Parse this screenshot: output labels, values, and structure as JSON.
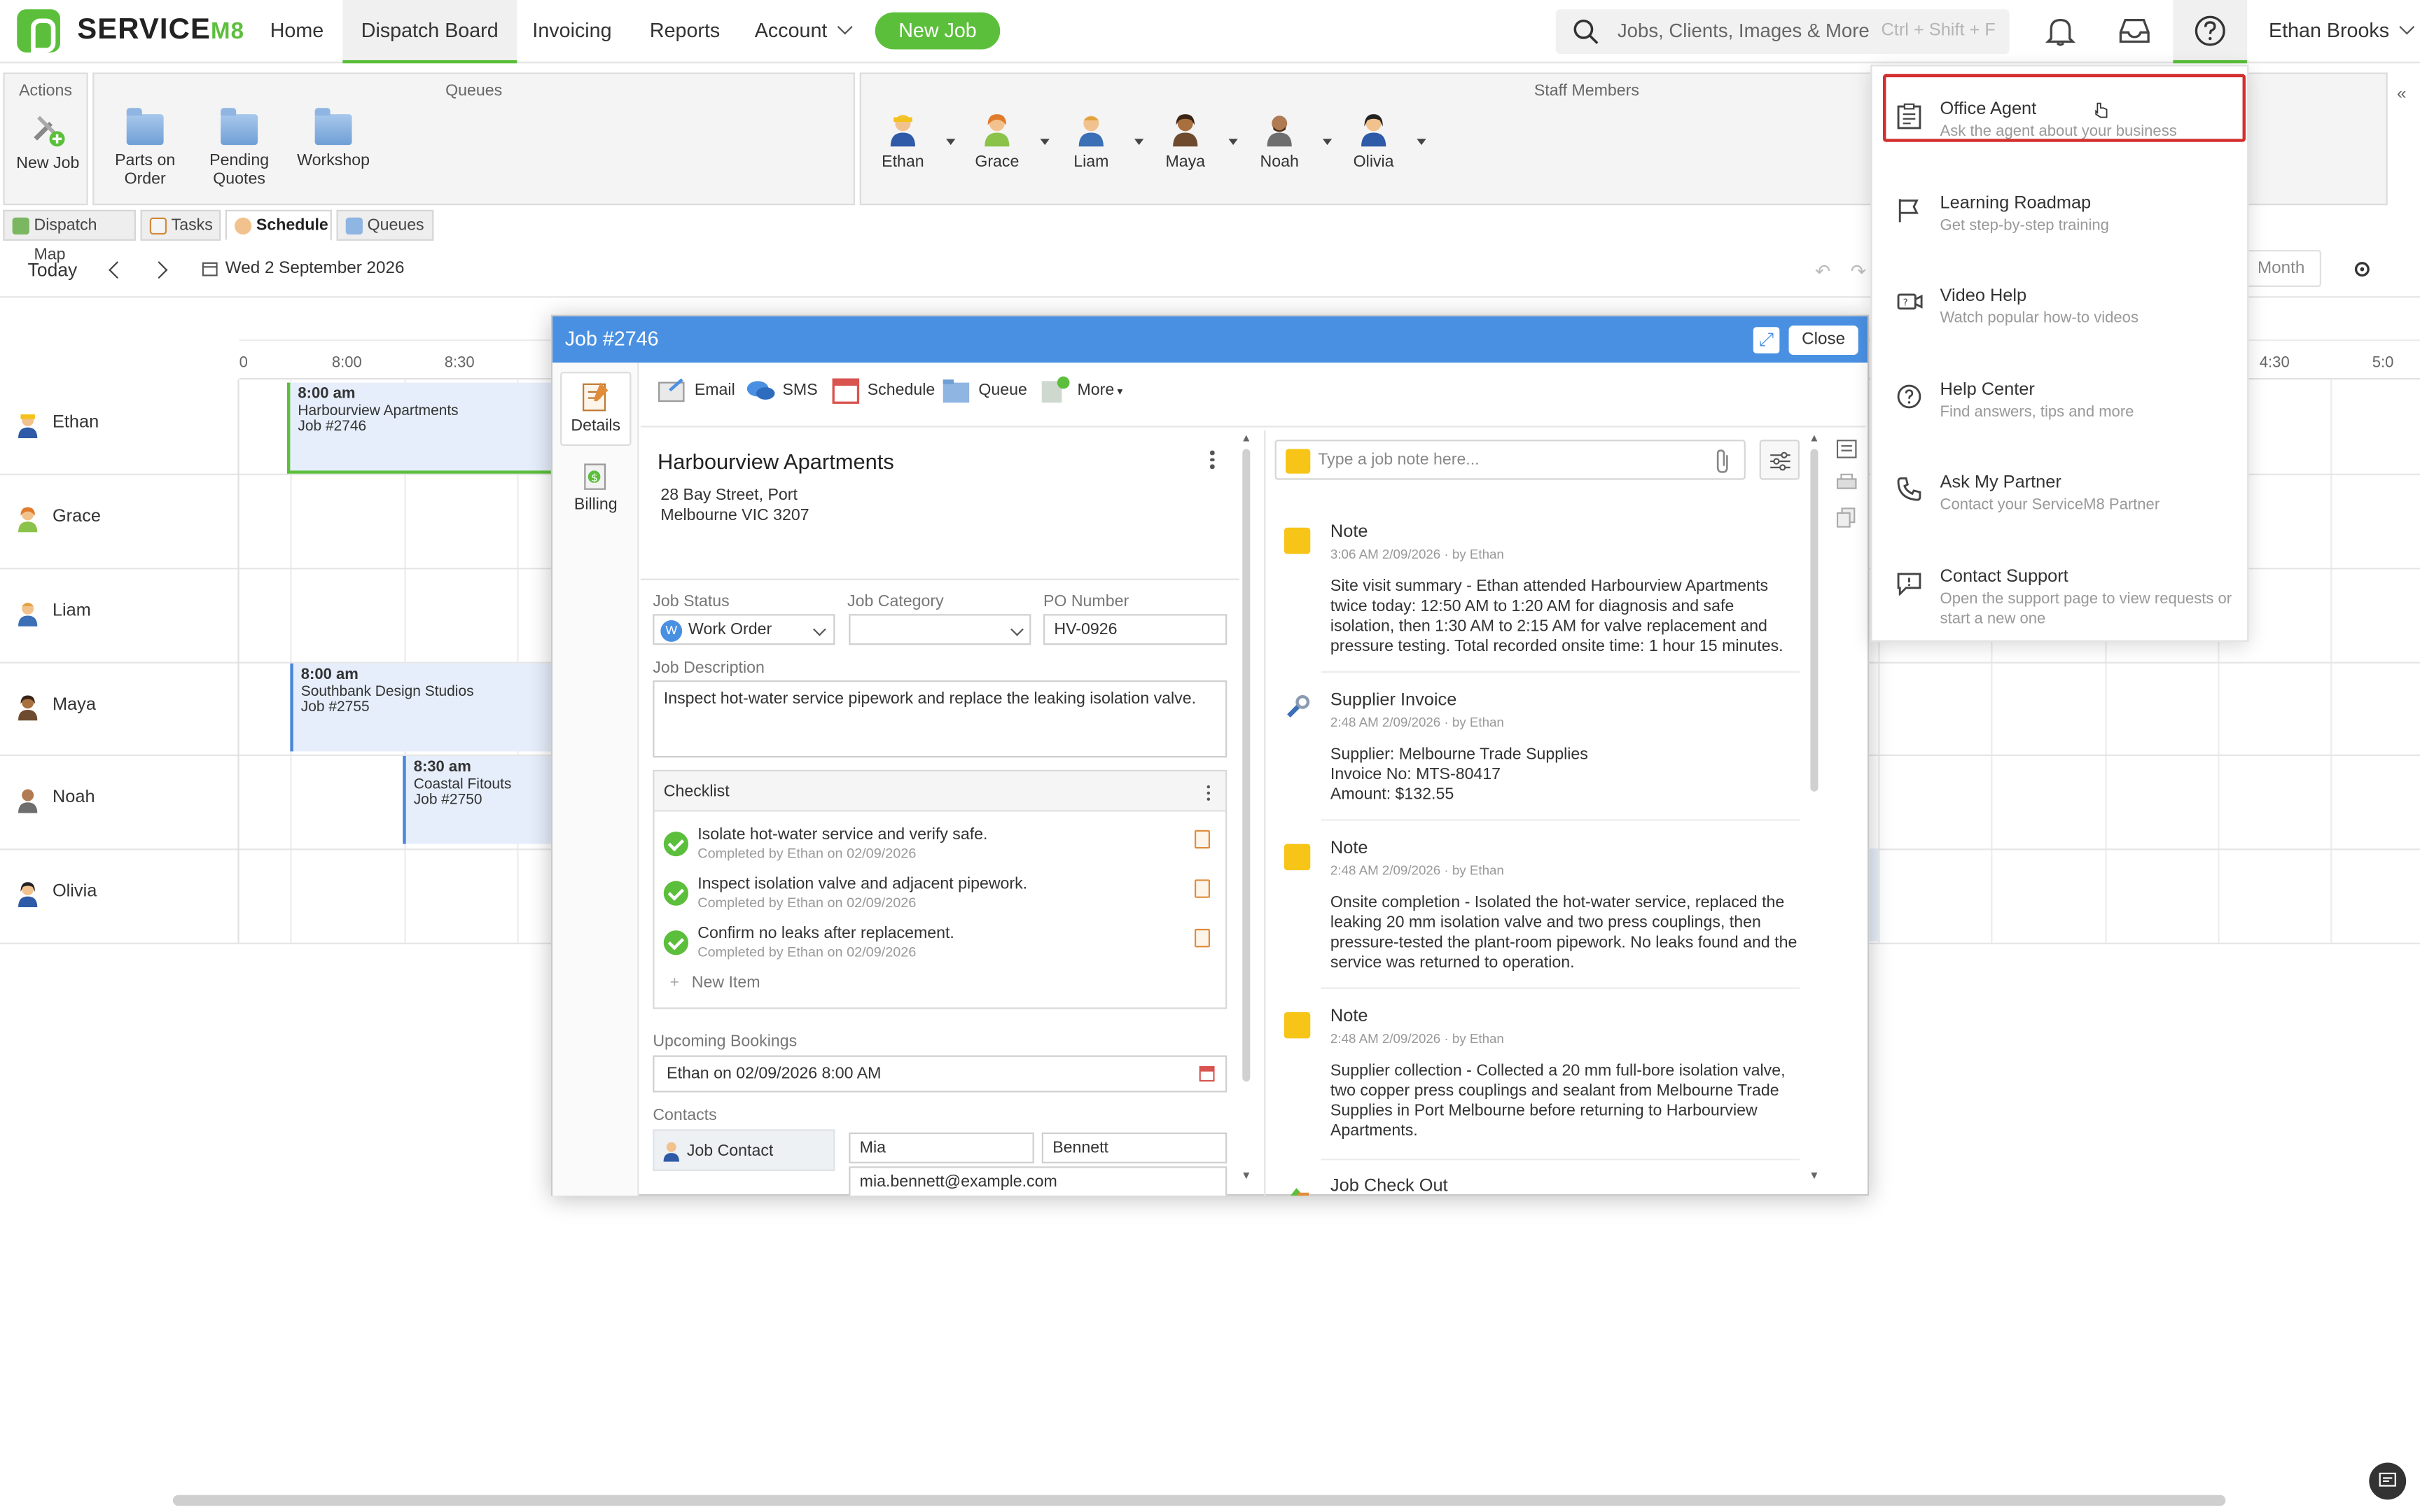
{
  "app": {
    "logo_text": "SERVICE",
    "logo_suffix": "M8",
    "nav": [
      "Home",
      "Dispatch Board",
      "Invoicing",
      "Reports",
      "Account"
    ],
    "new_job": "New Job",
    "search_placeholder": "Jobs, Clients, Images & More",
    "search_shortcut": "Ctrl + Shift + F",
    "user": "Ethan Brooks"
  },
  "toolbar": {
    "actions_title": "Actions",
    "actions": [
      "New Job"
    ],
    "queues_title": "Queues",
    "queues": [
      "Parts on Order",
      "Pending Quotes",
      "Workshop"
    ],
    "staff_title": "Staff Members",
    "staff": [
      "Ethan",
      "Grace",
      "Liam",
      "Maya",
      "Noah",
      "Olivia"
    ]
  },
  "tabs": [
    "Dispatch Map",
    "Tasks",
    "Schedule",
    "Queues"
  ],
  "datebar": {
    "today": "Today",
    "date": "Wed 2 September 2026",
    "month": "Month"
  },
  "schedule": {
    "times": [
      "0",
      "8:00",
      "8:30",
      "4:30",
      "5:0"
    ],
    "rows": [
      "Ethan",
      "Grace",
      "Liam",
      "Maya",
      "Noah",
      "Olivia"
    ],
    "bookings": [
      {
        "time": "8:00 am",
        "client": "Harbourview Apartments",
        "job": "Job #2746"
      },
      {
        "time": "8:00 am",
        "client": "Southbank Design Studios",
        "job": "Job #2755"
      },
      {
        "time": "8:30 am",
        "client": "Coastal Fitouts",
        "job": "Job #2750"
      }
    ]
  },
  "modal": {
    "title": "Job #2746",
    "close": "Close",
    "leftnav": [
      "Details",
      "Billing"
    ],
    "actions": [
      "Email",
      "SMS",
      "Schedule",
      "Queue",
      "More"
    ],
    "client": "Harbourview Apartments",
    "address_line1": "28 Bay Street, Port",
    "address_line2": "Melbourne VIC 3207",
    "job_status_label": "Job Status",
    "job_status_value": "Work Order",
    "job_category_label": "Job Category",
    "job_category_value": "",
    "po_label": "PO Number",
    "po_value": "HV-0926",
    "desc_label": "Job Description",
    "desc_value": "Inspect hot-water service pipework and replace the leaking isolation valve.",
    "checklist_title": "Checklist",
    "checklist": [
      {
        "text": "Isolate hot-water service and verify safe.",
        "sub": "Completed by Ethan on 02/09/2026"
      },
      {
        "text": "Inspect isolation valve and adjacent pipework.",
        "sub": "Completed by Ethan on 02/09/2026"
      },
      {
        "text": "Confirm no leaks after replacement.",
        "sub": "Completed by Ethan on 02/09/2026"
      }
    ],
    "new_item": "New Item",
    "upcoming_label": "Upcoming Bookings",
    "upcoming_value": "Ethan on 02/09/2026 8:00 AM",
    "contacts_label": "Contacts",
    "contact_type": "Job Contact",
    "contact_first": "Mia",
    "contact_last": "Bennett",
    "contact_email": "mia.bennett@example.com",
    "note_placeholder": "Type a job note here...",
    "feed": [
      {
        "type": "Note",
        "meta": "3:06 AM 2/09/2026  ·  by Ethan",
        "body": "Site visit summary - Ethan attended Harbourview Apartments twice today: 12:50 AM to 1:20 AM for diagnosis and safe isolation, then 1:30 AM to 2:15 AM for valve replacement and pressure testing. Total recorded onsite time: 1 hour 15 minutes."
      },
      {
        "type": "Supplier Invoice",
        "meta": "2:48 AM 2/09/2026  ·  by Ethan",
        "body_lines": [
          "Supplier: Melbourne Trade Supplies",
          "Invoice No: MTS-80417",
          "Amount: $132.55"
        ]
      },
      {
        "type": "Note",
        "meta": "2:48 AM 2/09/2026  ·  by Ethan",
        "body": "Onsite completion - Isolated the hot-water service, replaced the leaking 20 mm isolation valve and two press couplings, then pressure-tested the plant-room pipework. No leaks found and the service was returned to operation."
      },
      {
        "type": "Note",
        "meta": "2:48 AM 2/09/2026  ·  by Ethan",
        "body": "Supplier collection - Collected a 20 mm full-bore isolation valve, two copper press couplings and sealant from Melbourne Trade Supplies in Port Melbourne before returning to Harbourview Apartments."
      },
      {
        "type": "Job Check Out",
        "meta": "",
        "body": ""
      }
    ]
  },
  "helpmenu": [
    {
      "title": "Office Agent",
      "sub": "Ask the agent about your business"
    },
    {
      "title": "Learning Roadmap",
      "sub": "Get step-by-step training"
    },
    {
      "title": "Video Help",
      "sub": "Watch popular how-to videos"
    },
    {
      "title": "Help Center",
      "sub": "Find answers, tips and more"
    },
    {
      "title": "Ask My Partner",
      "sub": "Contact your ServiceM8 Partner"
    },
    {
      "title": "Contact Support",
      "sub": "Open the support page to view requests or start a new one"
    }
  ],
  "colors": {
    "brand": "#5bbf3b",
    "modal_header": "#4a90e2",
    "highlight": "#d32f2f"
  }
}
